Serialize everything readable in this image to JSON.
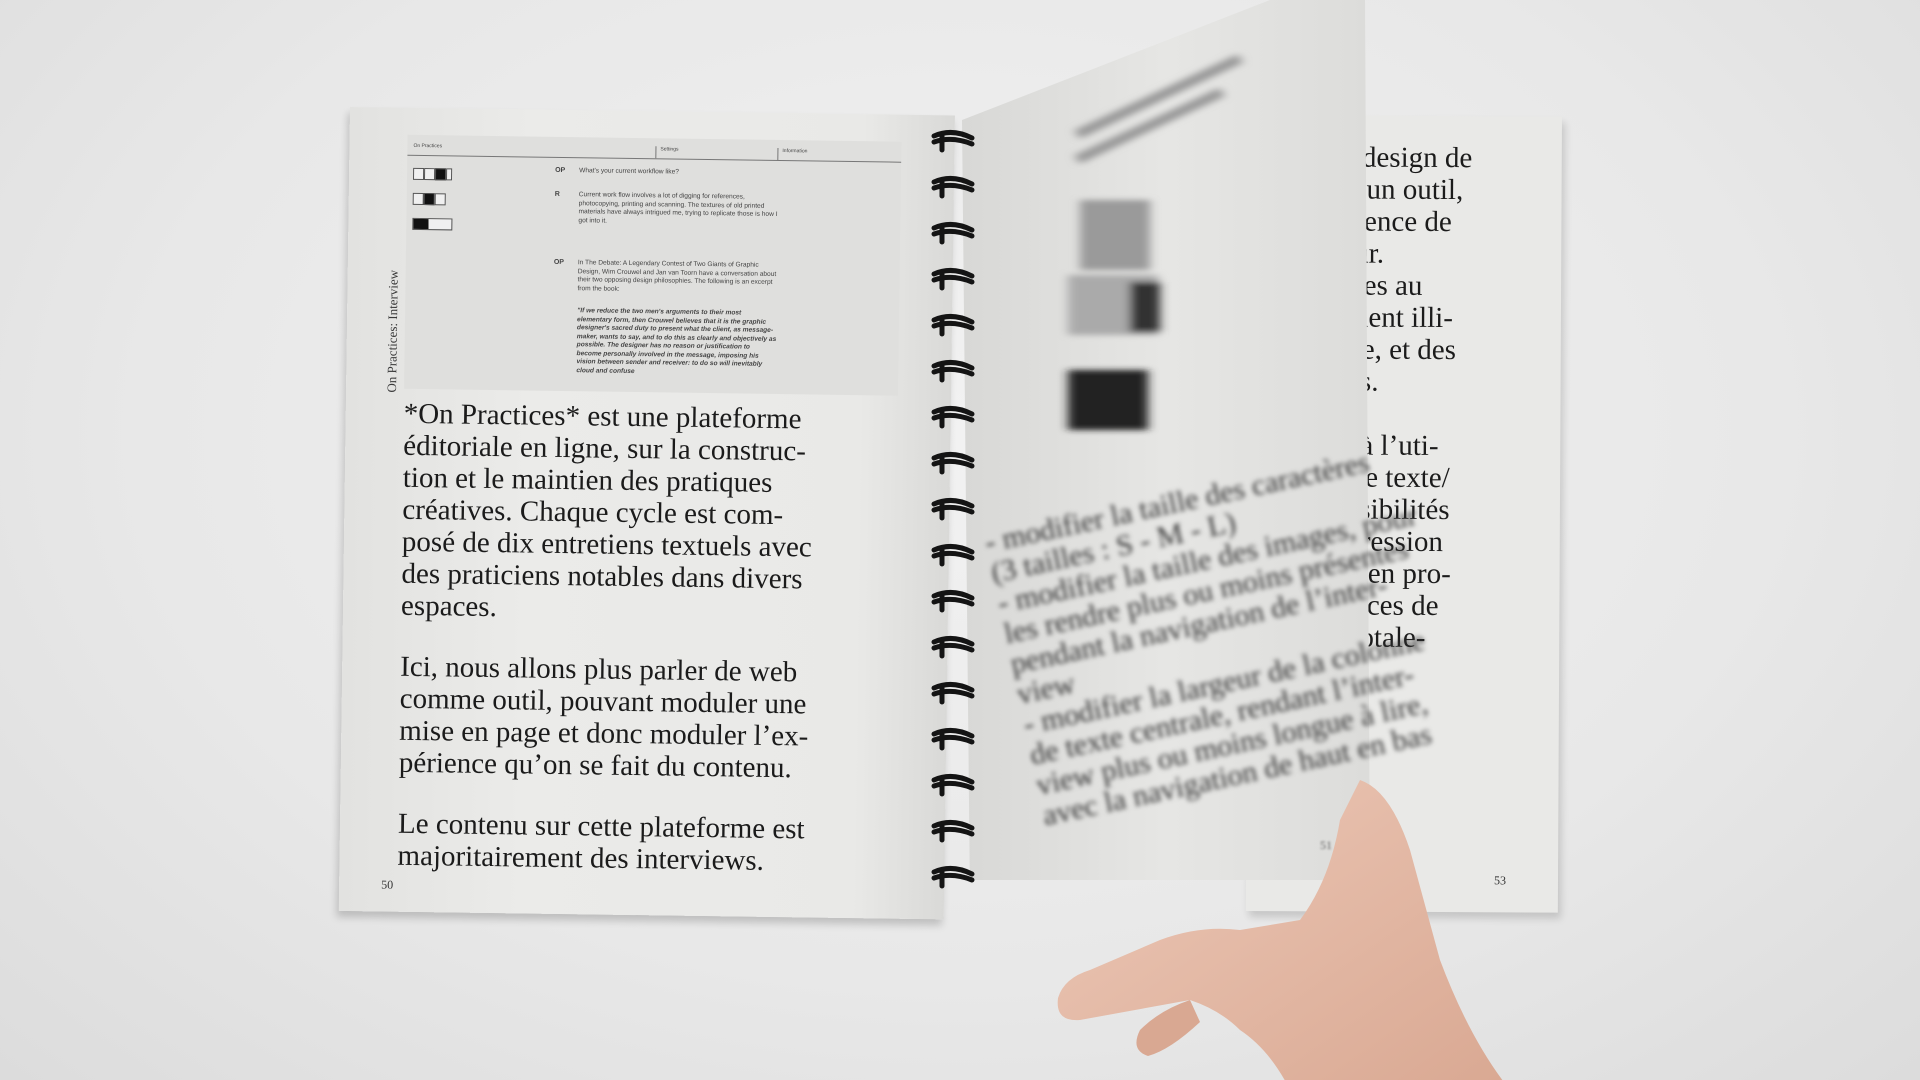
{
  "left_page": {
    "section_label": "On Practices: Interview",
    "screenshot": {
      "tabs": [
        "On Practices",
        "Settings",
        "Information"
      ],
      "entries": [
        {
          "speaker": "OP",
          "text": "What's your current workflow like?"
        },
        {
          "speaker": "R",
          "text": "Current work flow involves a lot of digging for references, photocopying, printing and scanning. The textures of old printed materials have always intrigued me, trying to replicate those is how I got into it."
        },
        {
          "speaker": "OP",
          "text": "In The Debate: A Legendary Contest of Two Giants of Graphic Design, Wim Crouwel and Jan van Toorn have a conversation about their two opposing design philosophies. The following is an excerpt from the book:"
        }
      ],
      "quote": "\"If we reduce the two men's arguments to their most elementary form, then Crouwel believes that it is the graphic designer's sacred duty to present what the client, as message-maker, wants to say, and to do this as clearly and objectively as possible. The designer has no reason or justification to become personally involved in the message, imposing his vision between sender and receiver: to do so will inevitably cloud and confuse"
    },
    "paragraphs": [
      "*On Practices* est une plateforme\néditoriale en ligne, sur la construc-\ntion et le maintien des pratiques\ncréatives. Chaque cycle est com-\nposé de dix entretiens textuels avec\ndes praticiens notables dans divers\nespaces.",
      "Ici, nous allons plus parler de web\ncomme outil, pouvant moduler une\nmise en page et donc moduler l’ex-\npérience qu’on se fait du contenu.",
      "Le contenu sur cette plateforme est\nmajoritairement des interviews."
    ],
    "page_number": "50"
  },
  "turning_page": {
    "lines": "- modifier la taille des caractères\n(3 tailles : S - M - L)\n- modifier la taille des images, pour\nles rendre plus ou moins présentes\npendant la navigation de l’inter-\nview\n- modifier la largeur de la colonne\nde texte centrale, rendant l’inter-\nview plus ou moins longue à lire,\navec la navigation de haut en bas",
    "page_number": "51"
  },
  "right_page": {
    "text": "le design de\nce un outil,\nérience de\nteur.\nêtres au\nevient illi-\ngne, et des\nnes.\n\net à l’uti-\ns de texte/\nensibilités\nnpression\niel en pro-\niences de\ne totale-",
    "page_number": "53"
  },
  "colors": {
    "background": "#ebebeb",
    "paper": "#e9e9e7",
    "ink": "#1b1b1b",
    "skin": "#e3b7a4"
  }
}
